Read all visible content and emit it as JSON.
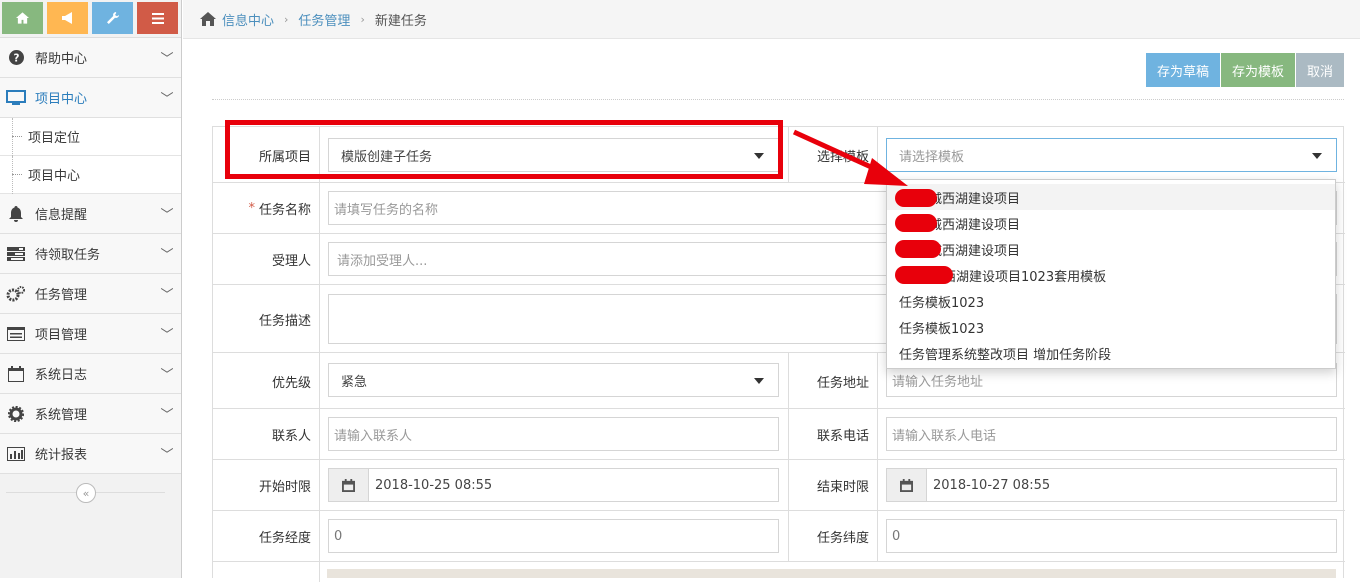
{
  "breadcrumb": {
    "home": "信息中心",
    "section": "任务管理",
    "current": "新建任务"
  },
  "sidebar": {
    "items": [
      {
        "label": "帮助中心"
      },
      {
        "label": "项目中心",
        "subs": [
          "项目定位",
          "项目中心"
        ]
      },
      {
        "label": "信息提醒"
      },
      {
        "label": "待领取任务"
      },
      {
        "label": "任务管理"
      },
      {
        "label": "项目管理"
      },
      {
        "label": "系统日志"
      },
      {
        "label": "系统管理"
      },
      {
        "label": "统计报表"
      }
    ],
    "collapse": "«"
  },
  "toolbar": {
    "draft": "存为草稿",
    "template": "存为模板",
    "cancel": "取消"
  },
  "form": {
    "project": {
      "label": "所属项目",
      "value": "模版创建子任务"
    },
    "template": {
      "label": "选择模板",
      "placeholder": "请选择模板"
    },
    "name": {
      "label": "任务名称",
      "placeholder": "请填写任务的名称"
    },
    "assignee": {
      "label": "受理人",
      "placeholder": "请添加受理人..."
    },
    "desc": {
      "label": "任务描述"
    },
    "priority": {
      "label": "优先级",
      "value": "紧急"
    },
    "address": {
      "label": "任务地址",
      "placeholder": "请输入任务地址"
    },
    "contact": {
      "label": "联系人",
      "placeholder": "请输入联系人"
    },
    "phone": {
      "label": "联系电话",
      "placeholder": "请输入联系人电话"
    },
    "start": {
      "label": "开始时限",
      "value": "2018-10-25 08:55"
    },
    "end": {
      "label": "结束时限",
      "value": "2018-10-27 08:55"
    },
    "lng": {
      "label": "任务经度",
      "value": "0"
    },
    "lat": {
      "label": "任务纬度",
      "value": "0"
    }
  },
  "template_options": [
    "城西湖建设项目",
    "城西湖建设项目",
    "城西湖建设项目",
    "西湖建设项目1023套用模板",
    "任务模板1023",
    "任务模板1023",
    "任务管理系统整改项目 增加任务阶段"
  ],
  "colors": {
    "accent": "#2b7dbc",
    "draft": "#6fb3e0",
    "save_template": "#87b87f",
    "cancel": "#abbac3",
    "annotation": "#e8000b"
  }
}
